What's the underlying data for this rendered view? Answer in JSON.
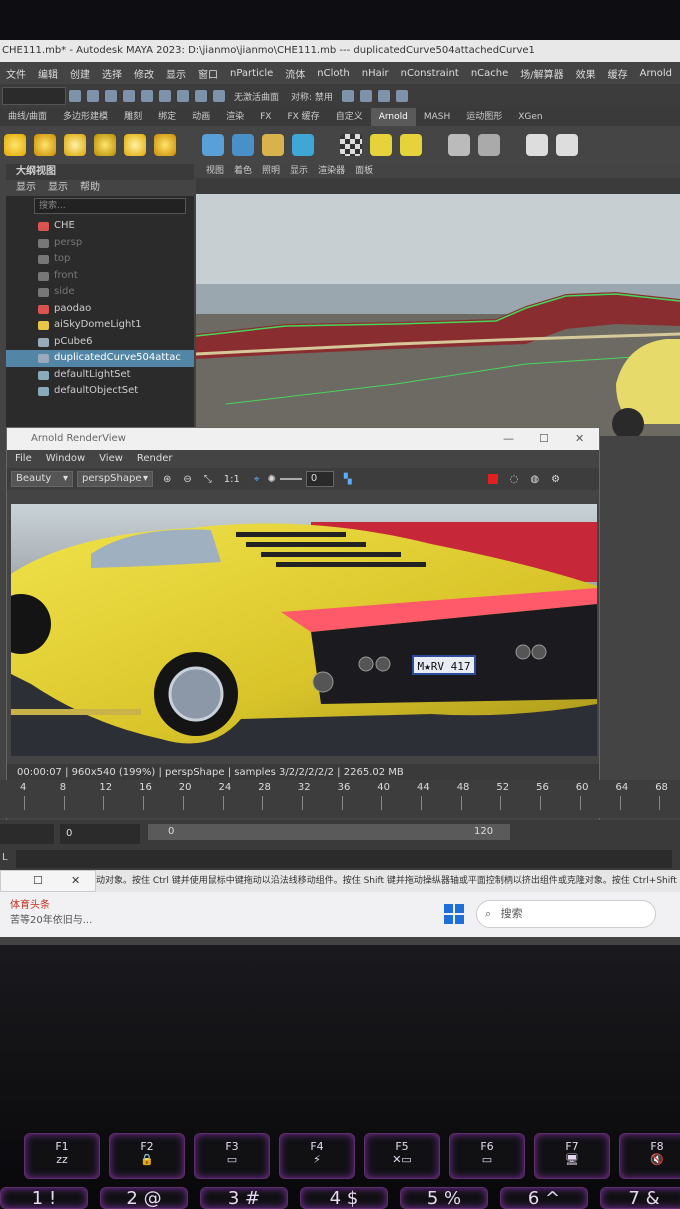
{
  "window": {
    "title": "CHE111.mb* - Autodesk MAYA 2023: D:\\jianmo\\jianmo\\CHE111.mb   ---   duplicatedCurve504attachedCurve1"
  },
  "menubar": [
    "文件",
    "编辑",
    "创建",
    "选择",
    "修改",
    "显示",
    "窗口",
    "nParticle",
    "流体",
    "nCloth",
    "nHair",
    "nConstraint",
    "nCache",
    "场/解算器",
    "效果",
    "缓存",
    "Arnold"
  ],
  "statusline": {
    "live_surface": "无激活曲面",
    "symmetry": "对称: 禁用"
  },
  "shelf_tabs": [
    "曲线/曲面",
    "多边形建模",
    "雕刻",
    "绑定",
    "动画",
    "渲染",
    "FX",
    "FX 缓存",
    "自定义",
    "Arnold",
    "MASH",
    "运动图形",
    "XGen"
  ],
  "shelf_active": "Arnold",
  "outliner": {
    "title": "大纲视图",
    "menu": [
      "显示",
      "显示",
      "帮助"
    ],
    "search_placeholder": "搜索...",
    "items": [
      {
        "label": "CHE",
        "dim": false,
        "selected": false,
        "icon_color": "#d9534f"
      },
      {
        "label": "persp",
        "dim": true,
        "selected": false,
        "icon_color": "#777"
      },
      {
        "label": "top",
        "dim": true,
        "selected": false,
        "icon_color": "#777"
      },
      {
        "label": "front",
        "dim": true,
        "selected": false,
        "icon_color": "#777"
      },
      {
        "label": "side",
        "dim": true,
        "selected": false,
        "icon_color": "#777"
      },
      {
        "label": "paodao",
        "dim": false,
        "selected": false,
        "icon_color": "#d9534f"
      },
      {
        "label": "aiSkyDomeLight1",
        "dim": false,
        "selected": false,
        "icon_color": "#e8c547"
      },
      {
        "label": "pCube6",
        "dim": false,
        "selected": false,
        "icon_color": "#9ab"
      },
      {
        "label": "duplicatedCurve504attac",
        "dim": false,
        "selected": true,
        "icon_color": "#9ab"
      },
      {
        "label": "defaultLightSet",
        "dim": false,
        "selected": false,
        "icon_color": "#8ab"
      },
      {
        "label": "defaultObjectSet",
        "dim": false,
        "selected": false,
        "icon_color": "#8ab"
      }
    ]
  },
  "viewport": {
    "menu": [
      "视图",
      "着色",
      "照明",
      "显示",
      "渲染器",
      "面板"
    ]
  },
  "renderview": {
    "title": "Arnold RenderView",
    "menu": [
      "File",
      "Window",
      "View",
      "Render"
    ],
    "aov": "Beauty",
    "camera": "perspShape",
    "ratio": "1:1",
    "exposure": "0",
    "plate": "M★RV 417",
    "status": "00:00:07 | 960x540 (199%) | perspShape | samples 3/2/2/2/2/2 | 2265.02 MB"
  },
  "timeline": {
    "ticks": [
      "4",
      "8",
      "12",
      "16",
      "20",
      "24",
      "28",
      "32",
      "36",
      "40",
      "44",
      "48",
      "52",
      "56",
      "60",
      "64",
      "68"
    ]
  },
  "range": {
    "current": "0",
    "start": "0",
    "end": "120"
  },
  "cmdline": {
    "label": "L"
  },
  "helpline": {
    "text": "动对象。按住 Ctrl 键并使用鼠标中键拖动以沿法线移动组件。按住 Shift 键并拖动操纵器轴或平面控制柄以挤出组件或克隆对象。按住 Ctrl+Shift"
  },
  "notification": {
    "title": "体育头条",
    "body": "苦等20年依旧与..."
  },
  "taskbar": {
    "search_placeholder": "搜索"
  },
  "keyboard": {
    "fkeys": [
      {
        "label": "F1",
        "icon": "zz"
      },
      {
        "label": "F2",
        "icon": "🔒"
      },
      {
        "label": "F3",
        "icon": "▭"
      },
      {
        "label": "F4",
        "icon": "⚡"
      },
      {
        "label": "F5",
        "icon": "✕▭"
      },
      {
        "label": "F6",
        "icon": "▭"
      },
      {
        "label": "F7",
        "icon": "🖥"
      },
      {
        "label": "F8",
        "icon": "🔇"
      }
    ],
    "numkeys": [
      "1 !",
      "2 @",
      "3 #",
      "4 $",
      "5 %",
      "6 ^",
      "7 &"
    ]
  },
  "colors": {
    "maya_bg": "#444444",
    "selection": "#5285a6",
    "car_yellow": "#e8d33a",
    "keyboard_glow": "#7b2fa0"
  }
}
